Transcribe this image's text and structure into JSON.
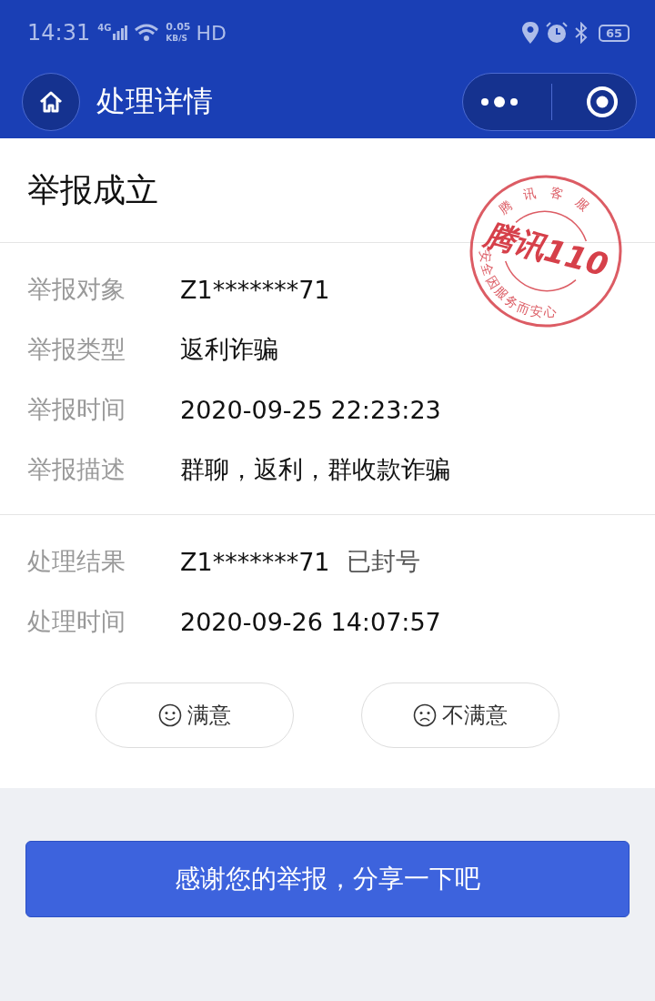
{
  "status_bar": {
    "time": "14:31",
    "network": "4G",
    "speed": "0.05",
    "speed_unit": "KB/S",
    "hd": "HD",
    "battery": "65"
  },
  "nav": {
    "title": "处理详情"
  },
  "header": {
    "title": "举报成立"
  },
  "stamp": {
    "top_text": "腾讯客服",
    "center_text": "腾讯110",
    "bottom_text": "安全因服务而安心"
  },
  "sections": [
    {
      "rows": [
        {
          "label": "举报对象",
          "value": "Z1*******71"
        },
        {
          "label": "举报类型",
          "value": "返利诈骗"
        },
        {
          "label": "举报时间",
          "value": "2020-09-25 22:23:23"
        },
        {
          "label": "举报描述",
          "value": "群聊，返利，群收款诈骗"
        }
      ]
    },
    {
      "rows": [
        {
          "label": "处理结果",
          "value": "Z1*******71",
          "tag": "已封号"
        },
        {
          "label": "处理时间",
          "value": "2020-09-26 14:07:57"
        }
      ]
    }
  ],
  "feedback": [
    {
      "kind": "happy",
      "label": "满意"
    },
    {
      "kind": "sad",
      "label": "不满意"
    }
  ],
  "share_button": "感谢您的举报，分享一下吧"
}
